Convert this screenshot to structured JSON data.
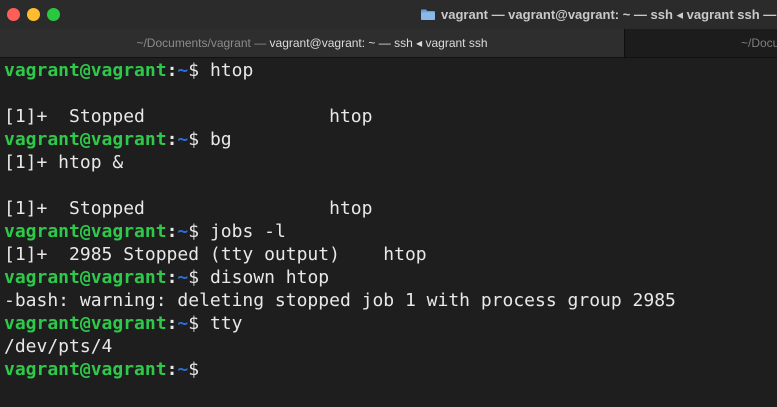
{
  "window": {
    "title": "vagrant — vagrant@vagrant: ~ — ssh ◂ vagrant ssh —",
    "traffic_lights": {
      "close_color": "#ff5f57",
      "minimize_color": "#febc2e",
      "maximize_color": "#28c840"
    }
  },
  "tabs": {
    "active": {
      "prefix": "~/Documents/vagrant — ",
      "main": "vagrant@vagrant: ~ — ssh ◂ vagrant ssh"
    },
    "inactive": {
      "label": "~/Docum"
    }
  },
  "colors": {
    "prompt_user": "#2ec94a",
    "prompt_path": "#2a6dd8",
    "terminal_bg": "#1e1e1e",
    "terminal_fg": "#e8e8e8"
  },
  "prompt": {
    "user_host": "vagrant@vagrant",
    "sep": ":",
    "path": "~",
    "dollar": "$ "
  },
  "terminal": {
    "cmd1": "htop",
    "out1": "[1]+  Stopped                 htop",
    "cmd2": "bg",
    "out2": "[1]+ htop &",
    "out3": "[1]+  Stopped                 htop",
    "cmd3": "jobs -l",
    "out4": "[1]+  2985 Stopped (tty output)    htop",
    "cmd4": "disown htop",
    "out5": "-bash: warning: deleting stopped job 1 with process group 2985",
    "cmd5": "tty",
    "out6": "/dev/pts/4",
    "cmd6": ""
  }
}
